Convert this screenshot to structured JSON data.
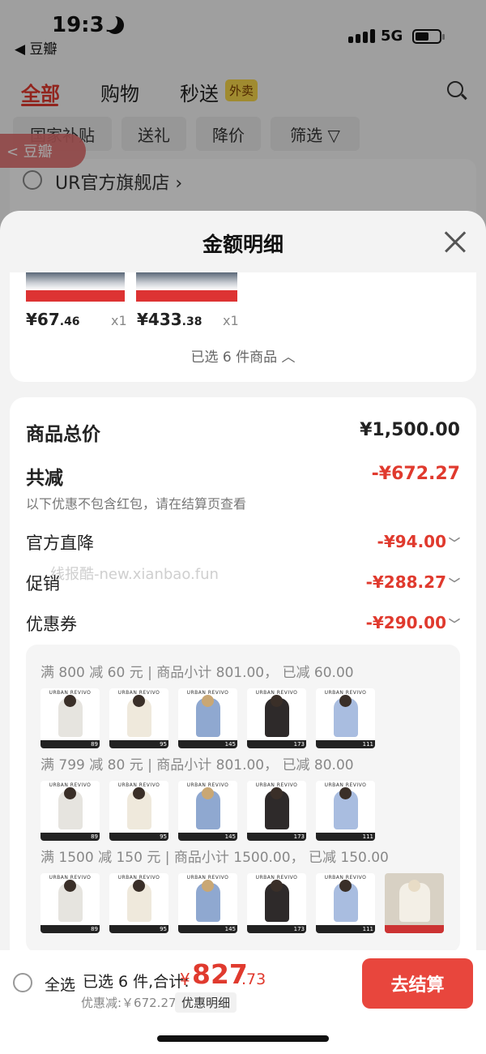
{
  "status": {
    "time": "19:31",
    "back_app": "◀ 豆瓣",
    "network": "5G"
  },
  "tabs": [
    {
      "label": "全部"
    },
    {
      "label": "购物"
    },
    {
      "label": "秒送"
    }
  ],
  "tab_badge": "外卖",
  "chips": [
    "国家补贴",
    "送礼",
    "降价",
    "筛选 ▽"
  ],
  "float_back": "< 豆瓣",
  "store": {
    "name": "UR官方旗舰店 ›"
  },
  "sheet": {
    "title": "金额明细",
    "products": [
      {
        "price_int": "¥67",
        "price_dec": ".46",
        "qty": "x1"
      },
      {
        "price_int": "¥433",
        "price_dec": ".38",
        "qty": "x1"
      }
    ],
    "selected_count": "已选 6 件商品 ︿"
  },
  "breakdown": {
    "total_label": "商品总价",
    "total_value": "¥1,500.00",
    "reduce_label": "共减",
    "reduce_value": "-¥672.27",
    "note": "以下优惠不包含红包，请在结算页查看",
    "items": [
      {
        "label": "官方直降",
        "value": "-¥94.00"
      },
      {
        "label": "促销",
        "value": "-¥288.27"
      },
      {
        "label": "优惠券",
        "value": "-¥290.00"
      }
    ],
    "watermark": "线报酷-new.xianbao.fun"
  },
  "promotions": [
    {
      "text": "满 800 减 60 元 | 商品小计 801.00， 已减 60.00",
      "tags": [
        "89",
        "95",
        "145",
        "173",
        "111"
      ]
    },
    {
      "text": "满 799 减 80 元 | 商品小计 801.00， 已减 80.00",
      "tags": [
        "89",
        "95",
        "145",
        "173",
        "111"
      ]
    },
    {
      "text": "满 1500 减 150 元 | 商品小计 1500.00， 已减 150.00",
      "tags": [
        "89",
        "95",
        "145",
        "173",
        "111",
        ""
      ]
    }
  ],
  "thumb_brand": "URBAN REVIVO",
  "bottom": {
    "select_all": "全选",
    "summary": "已选 6 件,合计:",
    "currency": "¥",
    "total_int": "827",
    "total_dec": ".73",
    "discount": "优惠减:￥672.27",
    "detail_chip": "优惠明细",
    "checkout": "去结算"
  },
  "colors": {
    "accent": "#e03a2e",
    "checkout_bg": "#e8463d"
  }
}
